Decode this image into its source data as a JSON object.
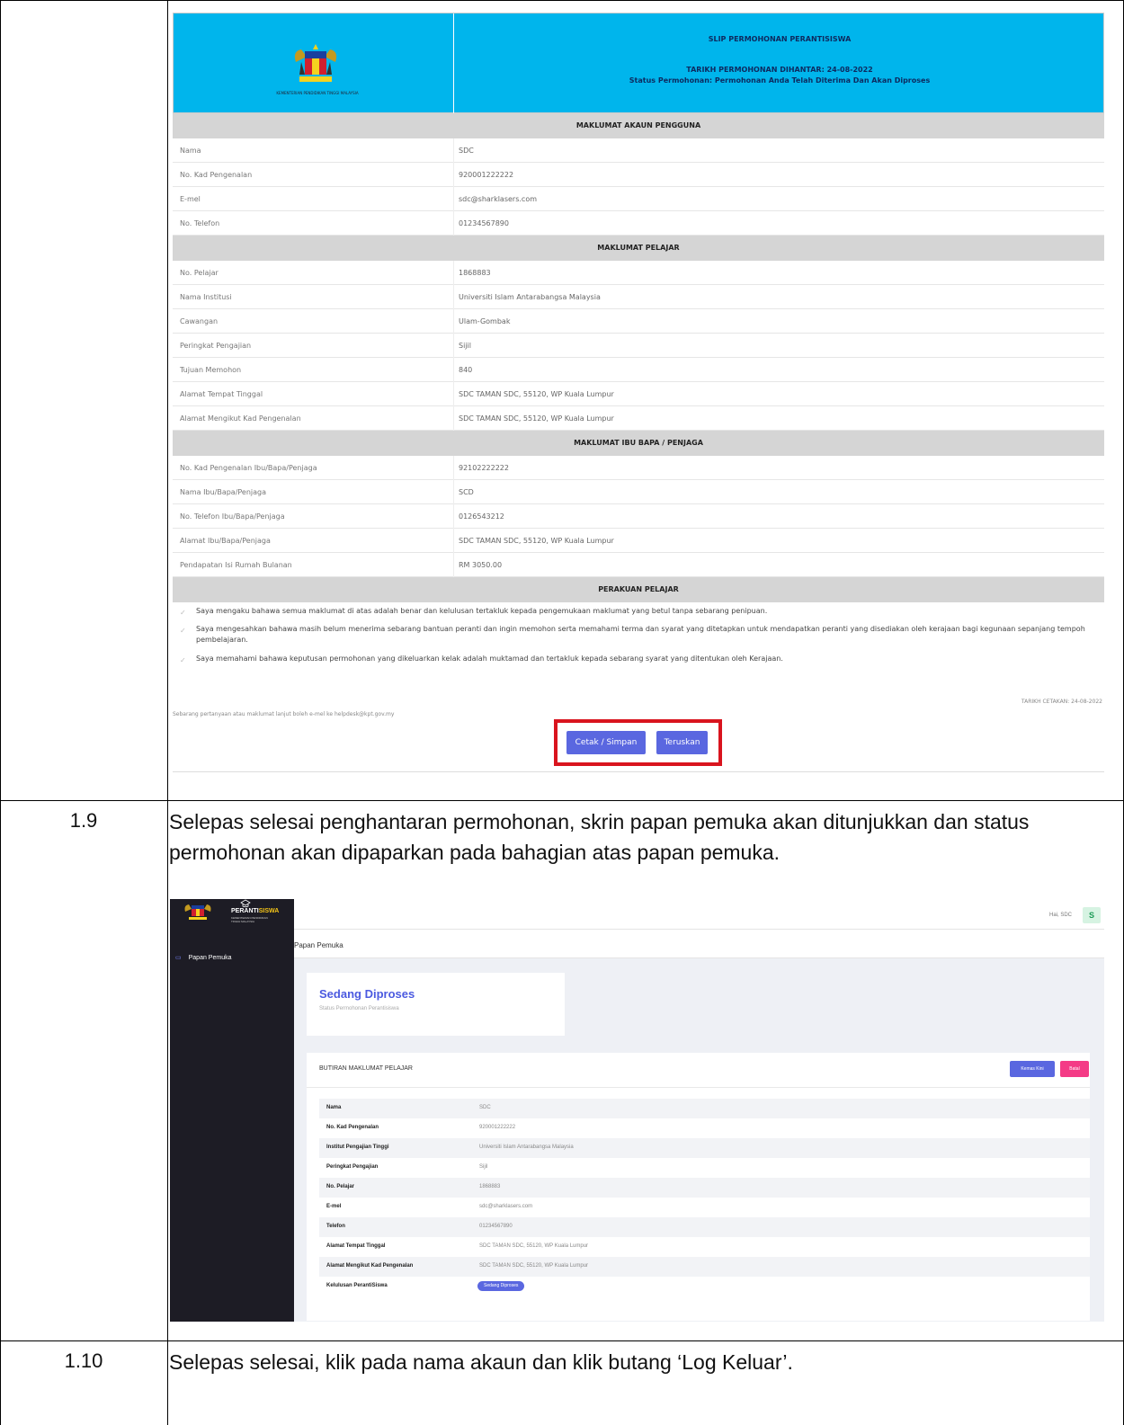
{
  "steps": [
    {
      "number": "1.9",
      "text": "Selepas selesai penghantaran permohonan, skrin papan pemuka akan ditunjukkan dan status permohonan akan dipaparkan pada bahagian atas papan pemuka."
    },
    {
      "number": "1.10",
      "text": "Selepas selesai, klik pada nama akaun dan klik butang ‘Log Keluar’."
    }
  ],
  "slip": {
    "logo_caption": "KEMENTERIAN PENDIDIKAN TINGGI MALAYSIA",
    "title": "SLIP PERMOHONAN PERANTISISWA",
    "date_line": "TARIKH PERMOHONAN DIHANTAR: 24-08-2022",
    "status_line": "Status Permohonan: Permohonan Anda Telah Diterima Dan Akan Diproses",
    "sections": [
      {
        "heading": "MAKLUMAT AKAUN PENGGUNA",
        "rows": [
          {
            "label": "Nama",
            "value": "SDC"
          },
          {
            "label": "No. Kad Pengenalan",
            "value": "920001222222"
          },
          {
            "label": "E-mel",
            "value": "sdc@sharklasers.com"
          },
          {
            "label": "No. Telefon",
            "value": "01234567890"
          }
        ]
      },
      {
        "heading": "MAKLUMAT PELAJAR",
        "rows": [
          {
            "label": "No. Pelajar",
            "value": "1868883"
          },
          {
            "label": "Nama Institusi",
            "value": "Universiti Islam Antarabangsa Malaysia"
          },
          {
            "label": "Cawangan",
            "value": "Ulam-Gombak"
          },
          {
            "label": "Peringkat Pengajian",
            "value": "Sijil"
          },
          {
            "label": "Tujuan Memohon",
            "value": "840"
          },
          {
            "label": "Alamat Tempat Tinggal",
            "value": "SDC TAMAN SDC, 55120, WP Kuala Lumpur"
          },
          {
            "label": "Alamat Mengikut Kad Pengenalan",
            "value": "SDC TAMAN SDC, 55120, WP Kuala Lumpur"
          }
        ]
      },
      {
        "heading": "MAKLUMAT IBU BAPA / PENJAGA",
        "rows": [
          {
            "label": "No. Kad Pengenalan Ibu/Bapa/Penjaga",
            "value": "92102222222"
          },
          {
            "label": "Nama Ibu/Bapa/Penjaga",
            "value": "SCD"
          },
          {
            "label": "No. Telefon Ibu/Bapa/Penjaga",
            "value": "0126543212"
          },
          {
            "label": "Alamat Ibu/Bapa/Penjaga",
            "value": "SDC TAMAN SDC, 55120, WP Kuala Lumpur"
          },
          {
            "label": "Pendapatan Isi Rumah Bulanan",
            "value": "RM 3050.00"
          }
        ]
      }
    ],
    "declaration_heading": "PERAKUAN PELAJAR",
    "declarations": [
      "Saya mengaku bahawa semua maklumat di atas adalah benar dan kelulusan tertakluk kepada pengemukaan maklumat yang betul tanpa sebarang penipuan.",
      "Saya mengesahkan bahawa masih belum menerima sebarang bantuan peranti dan ingin memohon serta memahami terma dan syarat yang ditetapkan untuk mendapatkan peranti yang disediakan oleh kerajaan bagi kegunaan sepanjang tempoh pembelajaran.",
      "Saya memahami bahawa keputusan permohonan yang dikeluarkan kelak adalah muktamad dan tertakluk kepada sebarang syarat yang ditentukan oleh Kerajaan."
    ],
    "footer_left": "Sebarang pertanyaan atau maklumat lanjut boleh e-mel ke helpdesk@kpt.gov.my",
    "footer_right": "TARIKH CETAKAN: 24-08-2022",
    "print_button": "Cetak / Simpan",
    "continue_button": "Teruskan"
  },
  "dashboard": {
    "brand": "PERANTI",
    "brand_accent": "SISWA",
    "brand_sub": "KEMENTERIAN PENDIDIKAN TINGGI MALAYSIA",
    "nav_item": "Papan Pemuka",
    "user_label": "Hai, SDC",
    "avatar_letter": "S",
    "page_title": "Papan Pemuka",
    "status_value": "Sedang Diproses",
    "status_caption": "Status Permohonan Perantisiswa",
    "card_title": "BUTIRAN MAKLUMAT PELAJAR",
    "update_button": "Kemas Kini",
    "cancel_button": "Batal",
    "rows": [
      {
        "label": "Nama",
        "value": "SDC"
      },
      {
        "label": "No. Kad Pengenalan",
        "value": "920001222222"
      },
      {
        "label": "Institut Pengajian Tinggi",
        "value": "Universiti Islam Antarabangsa Malaysia"
      },
      {
        "label": "Peringkat Pengajian",
        "value": "Sijil"
      },
      {
        "label": "No. Pelajar",
        "value": "1868883"
      },
      {
        "label": "E-mel",
        "value": "sdc@sharklasers.com"
      },
      {
        "label": "Telefon",
        "value": "01234567890"
      },
      {
        "label": "Alamat Tempat Tinggal",
        "value": "SDC TAMAN SDC, 55120, WP Kuala Lumpur"
      },
      {
        "label": "Alamat Mengikut Kad Pengenalan",
        "value": "SDC TAMAN SDC, 55120, WP Kuala Lumpur"
      },
      {
        "label": "Kelulusan PerantiSiswa",
        "badge": "Sedang Diproses"
      }
    ]
  },
  "colors": {
    "slip_header": "#00b5ec",
    "primary_button": "#5a67e0",
    "cancel_button": "#f43b86",
    "highlight_box": "#d9141e",
    "sidebar": "#1d1c25"
  }
}
